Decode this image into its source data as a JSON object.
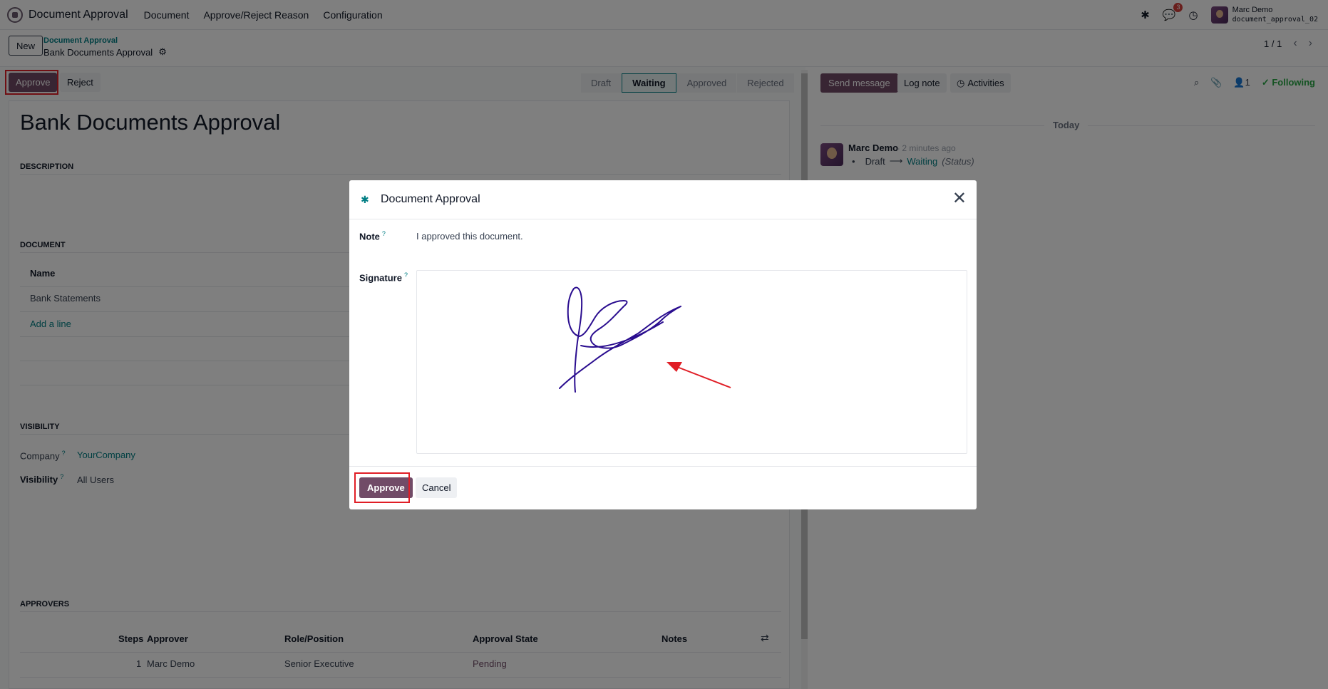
{
  "navbar": {
    "app_name": "Document Approval",
    "menu": [
      "Document",
      "Approve/Reject Reason",
      "Configuration"
    ],
    "messages_badge": "3",
    "user_name": "Marc Demo",
    "database": "document_approval_02"
  },
  "control": {
    "new_label": "New",
    "breadcrumb_parent": "Document Approval",
    "breadcrumb_current": "Bank Documents Approval",
    "pager": "1 / 1"
  },
  "statusbar": {
    "approve_label": "Approve",
    "reject_label": "Reject",
    "stages": [
      "Draft",
      "Waiting",
      "Approved",
      "Rejected"
    ],
    "active_stage": "Waiting"
  },
  "form": {
    "title": "Bank Documents Approval",
    "description_heading": "DESCRIPTION",
    "document_heading": "DOCUMENT",
    "document_col": "Name",
    "document_rows": [
      "Bank Statements"
    ],
    "add_line": "Add a line",
    "visibility_heading": "VISIBILITY",
    "company_label": "Company",
    "company_value": "YourCompany",
    "visibility_label": "Visibility",
    "visibility_value": "All Users",
    "approvers_heading": "APPROVERS",
    "approver_cols": [
      "Steps",
      "Approver",
      "Role/Position",
      "Approval State",
      "Notes"
    ],
    "approver_rows": [
      {
        "step": "1",
        "approver": "Marc Demo",
        "role": "Senior Executive",
        "state": "Pending",
        "notes": ""
      }
    ]
  },
  "chatter": {
    "send_message": "Send message",
    "log_note": "Log note",
    "activities": "Activities",
    "followers_count": "1",
    "following": "Following",
    "today": "Today",
    "author": "Marc Demo",
    "time": "- 2 minutes ago",
    "change_from": "Draft",
    "change_to": "Waiting",
    "change_field": "(Status)"
  },
  "modal": {
    "title": "Document Approval",
    "note_label": "Note",
    "note_value": "I approved this document.",
    "signature_label": "Signature",
    "approve_label": "Approve",
    "cancel_label": "Cancel",
    "help_mark": "?"
  },
  "colors": {
    "brand": "#714b67",
    "teal": "#017e84",
    "highlight": "#e01e26",
    "signature_ink": "#2a0d8f"
  }
}
